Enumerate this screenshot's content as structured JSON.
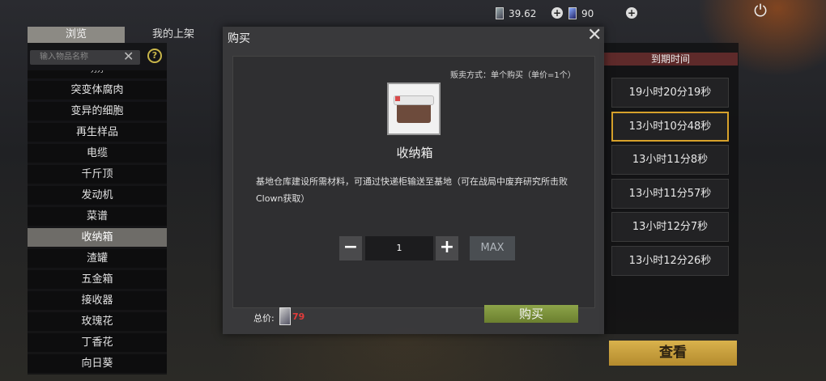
{
  "currency": {
    "silver": "39.62",
    "gold": "90",
    "silver_icon": "silver-chip-icon",
    "gold_icon": "gold-chip-icon"
  },
  "tabs": {
    "browse": "浏览",
    "my_listings": "我的上架"
  },
  "search": {
    "placeholder": "输入物品名称"
  },
  "categories": [
    {
      "label": "刀刀",
      "partial": true
    },
    {
      "label": "突变体腐肉"
    },
    {
      "label": "变异的细胞"
    },
    {
      "label": "再生样品"
    },
    {
      "label": "电缆"
    },
    {
      "label": "千斤顶"
    },
    {
      "label": "发动机"
    },
    {
      "label": "菜谱"
    },
    {
      "label": "收纳箱",
      "active": true
    },
    {
      "label": "渣罐"
    },
    {
      "label": "五金箱"
    },
    {
      "label": "接收器"
    },
    {
      "label": "玫瑰花"
    },
    {
      "label": "丁香花"
    },
    {
      "label": "向日葵"
    }
  ],
  "right": {
    "header": "到期时间",
    "timers": [
      "19小时20分19秒",
      "13小时10分48秒",
      "13小时11分8秒",
      "13小时11分57秒",
      "13小时12分7秒",
      "13小时12分26秒"
    ],
    "selected_index": 1,
    "view_button": "查看"
  },
  "modal": {
    "title": "购买",
    "sale_method": "贩卖方式：单个购买（单价=1个）",
    "item_name": "收纳箱",
    "item_description": "基地仓库建设所需材料，可通过快递柜输送至基地（可在战局中废弃研究所击败Clown获取）",
    "quantity": "1",
    "max_label": "MAX",
    "total_label": "总价:",
    "total_value": "79",
    "buy_label": "购买"
  },
  "colors": {
    "accent_gold": "#d7a12b",
    "buy_green": "#7d933c",
    "price_red": "#e23b3b",
    "header_red": "#5e2a2a"
  }
}
